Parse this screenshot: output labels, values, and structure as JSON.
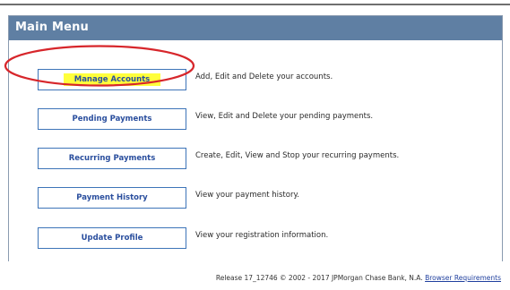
{
  "panel": {
    "title": "Main Menu"
  },
  "menu": {
    "items": [
      {
        "label": "Manage Accounts",
        "description": "Add, Edit and Delete your accounts."
      },
      {
        "label": "Pending Payments",
        "description": "View, Edit and Delete your pending payments."
      },
      {
        "label": "Recurring Payments",
        "description": "Create, Edit, View and Stop your recurring payments."
      },
      {
        "label": "Payment History",
        "description": "View your payment history."
      },
      {
        "label": "Update Profile",
        "description": "View your registration information."
      }
    ]
  },
  "footer": {
    "release_text": "Release 17_12746 © 2002 - 2017 JPMorgan Chase Bank, N.A.",
    "link_label": "Browser Requirements"
  },
  "colors": {
    "header_bg": "#5f7fa3",
    "button_border": "#3d74b8",
    "highlight": "#ffff3c",
    "annotation": "#d7262b"
  }
}
